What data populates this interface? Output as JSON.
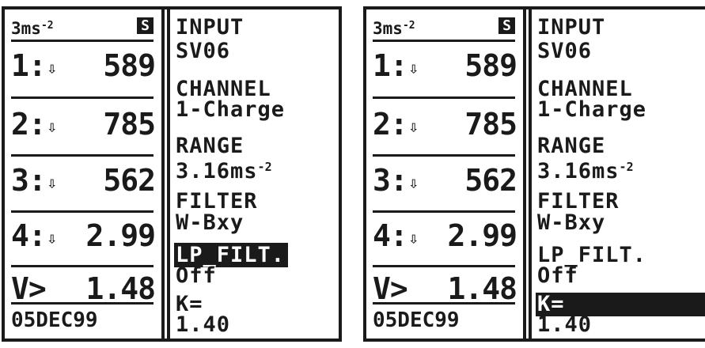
{
  "screens": [
    {
      "header": {
        "range": "3ms",
        "exp": "-2",
        "mode_badge": "S"
      },
      "channels": [
        {
          "label": "1:",
          "arrow": "⇩",
          "value": "589"
        },
        {
          "label": "2:",
          "arrow": "⇩",
          "value": "785"
        },
        {
          "label": "3:",
          "arrow": "⇩",
          "value": "562"
        },
        {
          "label": "4:",
          "arrow": "⇩",
          "value": "2.99"
        },
        {
          "label": "V>",
          "arrow": "",
          "value": "1.48"
        }
      ],
      "date": "05DEC99",
      "menu": {
        "input_label": "INPUT",
        "input_value": "SV06",
        "channel_label": "CHANNEL",
        "channel_value": "1-Charge",
        "range_label": "RANGE",
        "range_value": "3.16ms",
        "range_exp": "-2",
        "filter_label": "FILTER",
        "filter_value": "W-Bxy",
        "lpfilt_label": "LP_FILT.",
        "lpfilt_value": "Off",
        "k_label": "K=",
        "k_value": "1.40"
      },
      "selected": "lp_filt"
    },
    {
      "header": {
        "range": "3ms",
        "exp": "-2",
        "mode_badge": "S"
      },
      "channels": [
        {
          "label": "1:",
          "arrow": "⇩",
          "value": "589"
        },
        {
          "label": "2:",
          "arrow": "⇩",
          "value": "785"
        },
        {
          "label": "3:",
          "arrow": "⇩",
          "value": "562"
        },
        {
          "label": "4:",
          "arrow": "⇩",
          "value": "2.99"
        },
        {
          "label": "V>",
          "arrow": "",
          "value": "1.48"
        }
      ],
      "date": "05DEC99",
      "menu": {
        "input_label": "INPUT",
        "input_value": "SV06",
        "channel_label": "CHANNEL",
        "channel_value": "1-Charge",
        "range_label": "RANGE",
        "range_value": "3.16ms",
        "range_exp": "-2",
        "filter_label": "FILTER",
        "filter_value": "W-Bxy",
        "lpfilt_label": "LP_FILT.",
        "lpfilt_value": "Off",
        "k_label": "K=",
        "k_value": "1.40"
      },
      "selected": "k"
    }
  ]
}
